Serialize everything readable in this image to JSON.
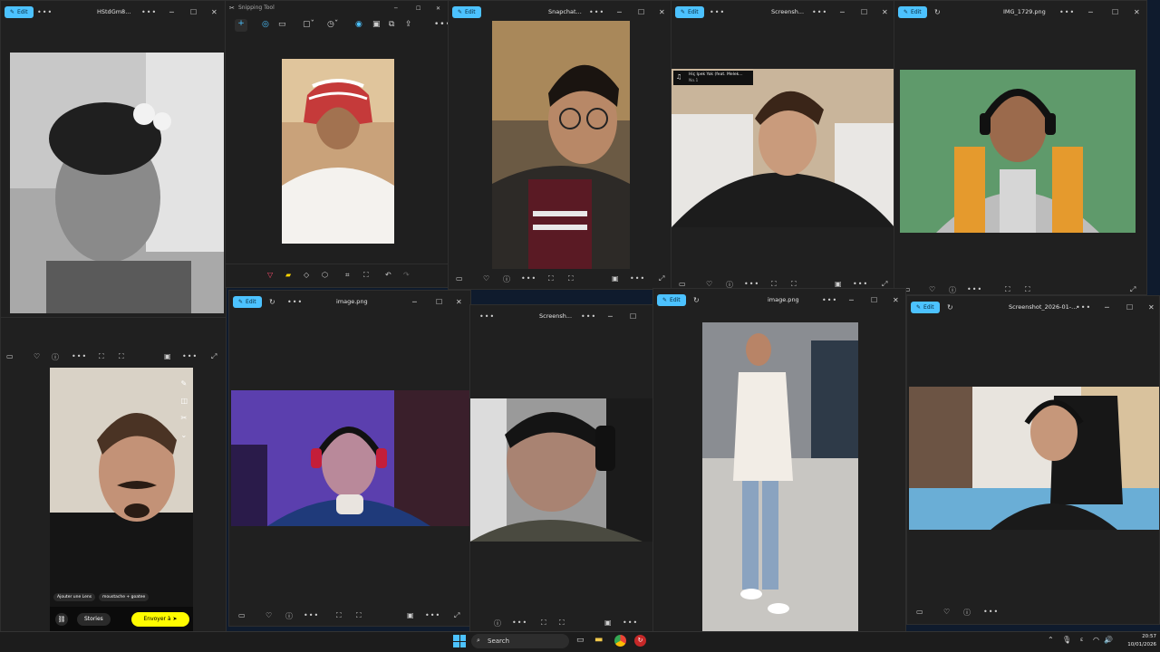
{
  "windows": {
    "w1": {
      "edit_label": "Edit",
      "title": "HStdGm8..."
    },
    "w2": {
      "app_title": "Snipping Tool"
    },
    "w3": {
      "edit_label": "Edit",
      "title": "Snapchat..."
    },
    "w4": {
      "edit_label": "Edit",
      "title": "Screensh...",
      "overlay_song": "Hiç Ipek Yok (feat. Melek...",
      "overlay_sub": "No.1"
    },
    "w5": {
      "edit_label": "Edit",
      "title": "IMG_1729.png"
    },
    "w6": {
      "chips": [
        "Ajouter une Lens",
        "moustache + goatee"
      ],
      "stories_label": "Stories",
      "send_label": "Envoyer à"
    },
    "w7": {
      "edit_label": "Edit",
      "title": "image.png"
    },
    "w8": {
      "title": "Screensh..."
    },
    "w9": {
      "edit_label": "Edit",
      "title": "image.png"
    },
    "w10": {
      "edit_label": "Edit",
      "title": "Screenshot_2026-01-..."
    }
  },
  "taskbar": {
    "search_placeholder": "Search",
    "time": "20:57",
    "date": "10/01/2026"
  },
  "colors": {
    "accent": "#4cc2ff",
    "window_bg": "#202020",
    "snap_yellow": "#fffc00"
  }
}
